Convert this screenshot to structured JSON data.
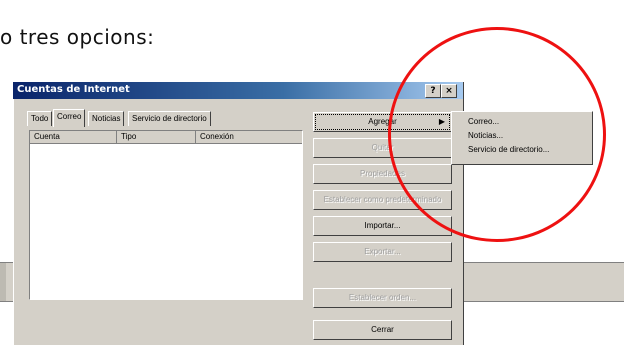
{
  "caption": "o tres opcions:",
  "dialog": {
    "title": "Cuentas de Internet",
    "help_glyph": "?",
    "close_glyph": "×",
    "tabs": [
      {
        "label": "Todo"
      },
      {
        "label": "Correo"
      },
      {
        "label": "Noticias"
      },
      {
        "label": "Servicio de directorio"
      }
    ],
    "columns": [
      "Cuenta",
      "Tipo",
      "Conexión"
    ],
    "buttons": {
      "agregar": "Agregar",
      "quitar": "Quitar",
      "propiedades": "Propiedades",
      "predeterminado": "Establecer como predeterminado",
      "importar": "Importar...",
      "exportar": "Exportar...",
      "establecer_orden": "Establecer orden...",
      "cerrar": "Cerrar",
      "submenu_arrow": "▶"
    },
    "menu": [
      "Correo...",
      "Noticias...",
      "Servicio de directorio..."
    ]
  },
  "colors": {
    "highlight_circle": "#ee1111",
    "title_bar": "#0a246a"
  }
}
